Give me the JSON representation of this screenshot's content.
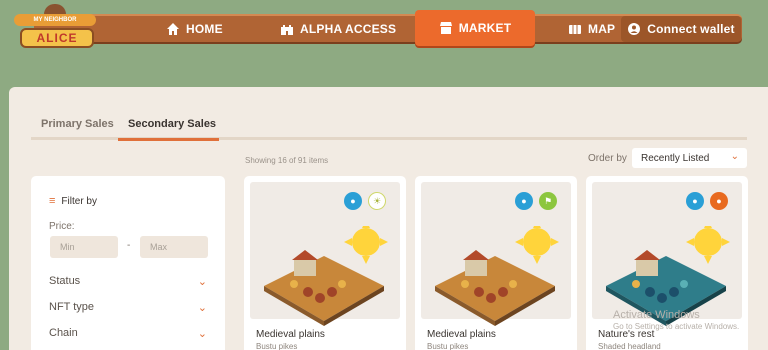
{
  "logo": {
    "top": "MY NEIGHBOR",
    "name": "ALICE"
  },
  "nav": {
    "home": "HOME",
    "alpha": "ALPHA ACCESS",
    "market": "MARKET",
    "map": "MAP",
    "wallet": "Connect wallet"
  },
  "tabs": {
    "primary": "Primary Sales",
    "secondary": "Secondary Sales"
  },
  "results": {
    "showing": "Showing 16 of 91 items"
  },
  "order": {
    "label": "Order by",
    "value": "Recently Listed"
  },
  "filter": {
    "title": "Filter by",
    "price_label": "Price:",
    "min_placeholder": "Min",
    "max_placeholder": "Max",
    "dash": "-",
    "facets": [
      "Status",
      "NFT type",
      "Chain"
    ]
  },
  "cards": [
    {
      "name": "Medieval plains",
      "sub": "Bustu pikes",
      "badges": [
        "water-drop-icon",
        "sun-icon"
      ],
      "ground": "#c8873a",
      "accent": "#e8b24a"
    },
    {
      "name": "Medieval plains",
      "sub": "Bustu pikes",
      "badges": [
        "water-drop-icon",
        "flag-icon"
      ],
      "ground": "#c8873a",
      "accent": "#e8b24a"
    },
    {
      "name": "Nature's rest",
      "sub": "Shaded headland",
      "badges": [
        "water-drop-icon",
        "pumpkin-icon"
      ],
      "ground": "#2f7d8a",
      "accent": "#5ab0b5"
    }
  ],
  "watermark": {
    "title": "Activate Windows",
    "sub": "Go to Settings to activate Windows."
  }
}
